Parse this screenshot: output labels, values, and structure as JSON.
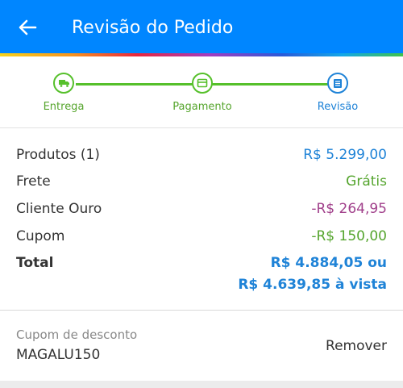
{
  "header": {
    "title": "Revisão do Pedido",
    "back_icon": "arrow-left-icon"
  },
  "steps": [
    {
      "label": "Entrega",
      "icon": "truck-icon",
      "state": "done"
    },
    {
      "label": "Pagamento",
      "icon": "card-icon",
      "state": "done"
    },
    {
      "label": "Revisão",
      "icon": "list-icon",
      "state": "active"
    }
  ],
  "summary": {
    "products_label": "Produtos (1)",
    "products_value": "R$ 5.299,00",
    "shipping_label": "Frete",
    "shipping_value": "Grátis",
    "gold_label": "Cliente Ouro",
    "gold_value": "-R$ 264,95",
    "coupon_label": "Cupom",
    "coupon_value": "-R$ 150,00",
    "total_label": "Total",
    "total_value": "R$ 4.884,05 ou",
    "total_cash": "R$ 4.639,85 à vista"
  },
  "coupon": {
    "label": "Cupom de desconto",
    "code": "MAGALU150",
    "remove_label": "Remover"
  },
  "colors": {
    "header": "#0086ff",
    "green": "#56c02b",
    "blue": "#1f83d7",
    "purple": "#a1408b"
  }
}
